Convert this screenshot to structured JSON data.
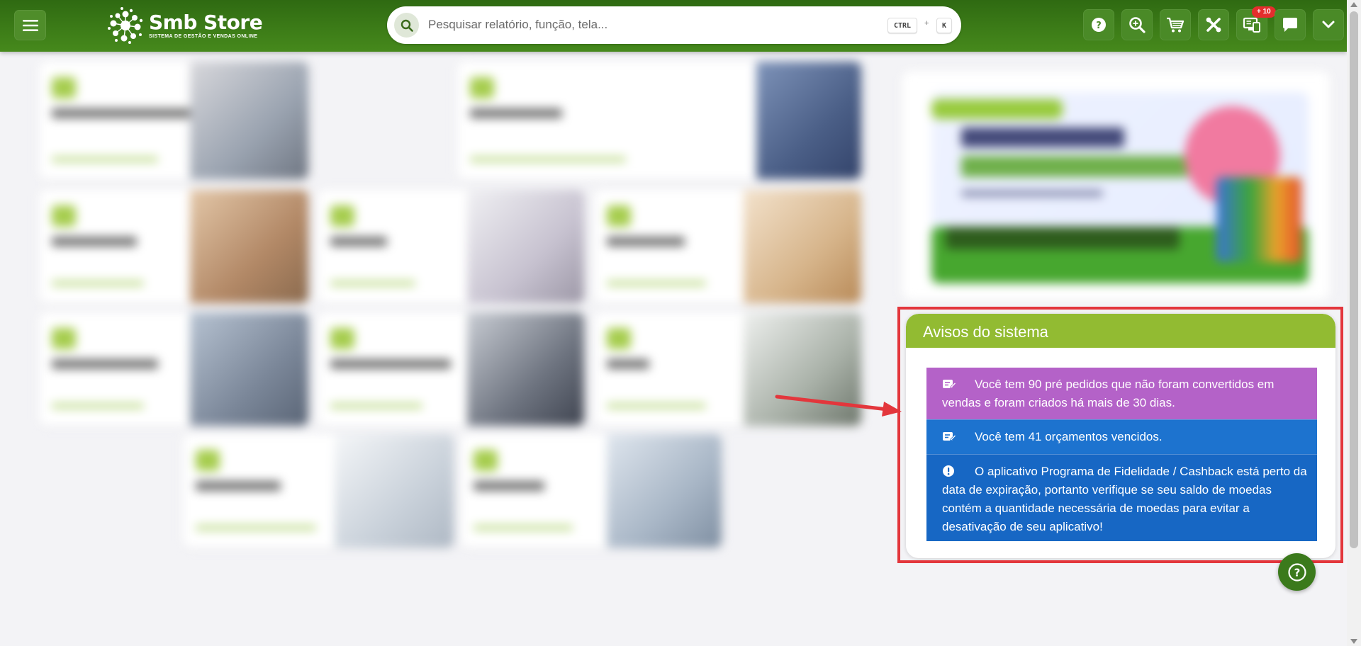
{
  "header": {
    "brand_title": "Smb Store",
    "brand_subtitle": "SISTEMA DE GESTÃO E VENDAS ONLINE",
    "search_placeholder": "Pesquisar relatório, função, tela...",
    "shortcut_ctrl": "CTRL",
    "shortcut_plus": "+",
    "shortcut_key": "K",
    "notification_badge": "+ 10",
    "icons": [
      "help-icon",
      "zoom-in-icon",
      "cart-icon",
      "tools-icon",
      "devices-icon",
      "chat-icon",
      "chevron-down-icon"
    ]
  },
  "notices": {
    "title": "Avisos do sistema",
    "items": [
      {
        "icon": "note-edit-icon",
        "color": "#b462c8",
        "text": "Você tem 90 pré pedidos que não foram convertidos em vendas e foram criados há mais de 30 dias."
      },
      {
        "icon": "note-edit-icon",
        "color": "#1d73cf",
        "text": "Você tem 41 orçamentos vencidos."
      },
      {
        "icon": "alert-circle-icon",
        "color": "#1767c4",
        "text": "O aplicativo Programa de Fidelidade / Cashback está perto da data de expiração, portanto verifique se seu saldo de moedas contém a quantidade necessária de moedas para evitar a desativação de seu aplicativo!"
      }
    ]
  },
  "colors": {
    "header_green": "#3d7d18",
    "notice_header": "#92bb32",
    "highlight_frame": "#e3363c",
    "arrow": "#e3363c"
  }
}
